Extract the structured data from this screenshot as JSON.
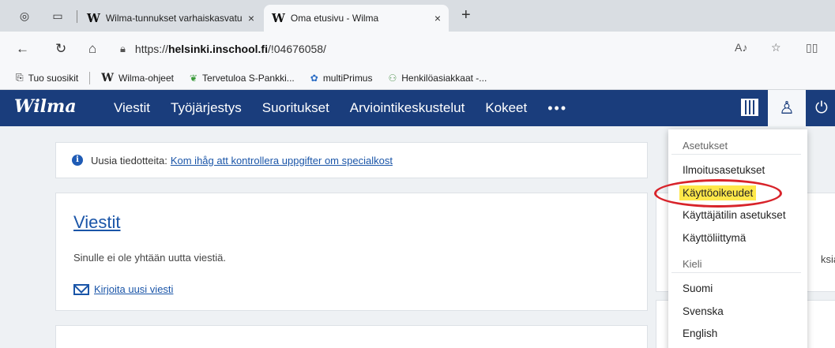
{
  "browser": {
    "tabs": [
      {
        "favicon": "W",
        "title": "Wilma-tunnukset varhaiskasvatu",
        "close": "×",
        "active": false
      },
      {
        "favicon": "W",
        "title": "Oma etusivu - Wilma",
        "close": "×",
        "active": true
      }
    ],
    "new_tab": "+",
    "url_scheme": "https://",
    "url_host": "helsinki.inschool.fi",
    "url_path": "/!04676058/",
    "bookmarks": [
      {
        "icon": "import-icon",
        "label": "Tuo suosikit"
      },
      {
        "icon": "wilma-icon",
        "label": "Wilma-ohjeet"
      },
      {
        "icon": "leaf-icon",
        "label": "Tervetuloa S-Pankki..."
      },
      {
        "icon": "flower-icon",
        "label": "multiPrimus"
      },
      {
        "icon": "people-icon",
        "label": "Henkilöasiakkaat -..."
      }
    ]
  },
  "wilma": {
    "logo": "Wilma",
    "nav": [
      "Viestit",
      "Työjärjestys",
      "Suoritukset",
      "Arviointikeskustelut",
      "Kokeet"
    ],
    "more": "•••"
  },
  "notice": {
    "prefix": "Uusia tiedotteita:",
    "link": "Kom ihåg att kontrollera uppgifter om specialkost"
  },
  "messages": {
    "title": "Viestit",
    "text": "Sinulle ei ole yhtään uutta viestiä.",
    "new_link": "Kirjoita uusi viesti"
  },
  "right_card": {
    "partial_text": "ksia."
  },
  "dropdown": {
    "settings_header": "Asetukset",
    "settings_items": [
      "Ilmoitusasetukset",
      "Käyttöoikeudet",
      "Käyttäjätilin asetukset",
      "Käyttöliittymä"
    ],
    "highlighted": "Käyttöoikeudet",
    "language_header": "Kieli",
    "language_items": [
      "Suomi",
      "Svenska",
      "English"
    ]
  },
  "colors": {
    "nav_bg": "#1a3d7c",
    "link": "#1a55a8",
    "highlight": "#ffe84a",
    "annotation": "#d8232a"
  }
}
